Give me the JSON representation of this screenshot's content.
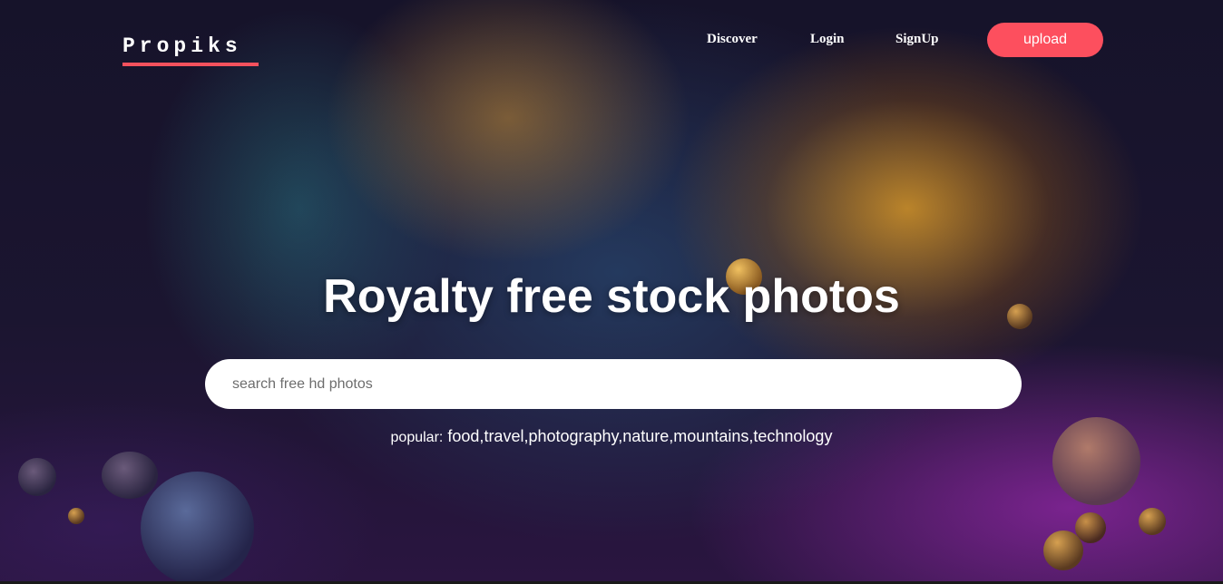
{
  "header": {
    "logo": "Propiks",
    "nav": [
      {
        "label": "Discover"
      },
      {
        "label": "Login"
      },
      {
        "label": "SignUp"
      }
    ],
    "upload_label": "upload"
  },
  "hero": {
    "title": "Royalty free stock photos",
    "search": {
      "placeholder": "search free hd photos",
      "value": ""
    },
    "popular_label": "popular:",
    "popular_tags": [
      "food",
      "travel",
      "photography",
      "nature",
      "mountains",
      "technology"
    ]
  },
  "colors": {
    "accent": "#fd4f5e",
    "logo_underline": "#f4515d"
  },
  "icons": {
    "background": "abstract-3d-render-image"
  }
}
